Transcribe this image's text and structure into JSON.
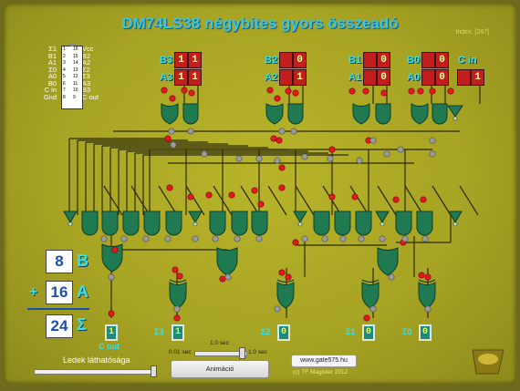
{
  "title": "DM74LS38 négybites gyors összeadó",
  "index_label": "Index: [287]",
  "chip": {
    "left_pins": [
      "Σ1",
      "B1",
      "A1",
      "Σ0",
      "A0",
      "B0",
      "C in",
      "Gnd"
    ],
    "right_pins": [
      "Vcc",
      "B2",
      "A2",
      "Σ2",
      "Σ3",
      "A3",
      "B3",
      "C out"
    ],
    "left_numbers": [
      "1",
      "2",
      "3",
      "4",
      "5",
      "6",
      "7",
      "8"
    ],
    "right_numbers": [
      "16",
      "15",
      "14",
      "13",
      "12",
      "11",
      "10",
      "9"
    ]
  },
  "inputs": {
    "B3": {
      "label": "B3",
      "value": "1"
    },
    "A3": {
      "label": "A3",
      "value": "1"
    },
    "B2": {
      "label": "B2",
      "value": "0"
    },
    "A2": {
      "label": "A2",
      "value": "1"
    },
    "B1": {
      "label": "B1",
      "value": "0"
    },
    "A1": {
      "label": "A1",
      "value": "0"
    },
    "B0": {
      "label": "B0",
      "value": "0"
    },
    "A0": {
      "label": "A0",
      "value": "0"
    },
    "Cin": {
      "label": "C in",
      "value": "1"
    }
  },
  "outputs": {
    "cout": {
      "label": "C out",
      "value": "1"
    },
    "s3": {
      "label": "Σ3",
      "value": "1"
    },
    "s2": {
      "label": "Σ2",
      "value": "0"
    },
    "s1": {
      "label": "Σ1",
      "value": "0"
    },
    "s0": {
      "label": "Σ0",
      "value": "0"
    }
  },
  "decimal": {
    "b_value": "8",
    "b_label": "B",
    "plus": "+",
    "a_value": "16",
    "a_label": "A",
    "sum_value": "24",
    "sum_label": "Σ"
  },
  "controls": {
    "animation_button": "Animáció",
    "speed_min": "0.01 sec",
    "speed_max": "1.0 sec",
    "speed_current": "1.0 sec",
    "led_visibility_label": "Ledek láthatósága",
    "url": "www.gate575.hu",
    "copyright": "(c)  TF Magister 2012"
  },
  "colors": {
    "background": "#a8a424",
    "title": "#36c8e8",
    "input_box": "#c31e1e",
    "gate": "#1e7a52",
    "led_on": "#e8161e",
    "led_off": "#9a9a9a",
    "wire": "#2a2a10"
  }
}
